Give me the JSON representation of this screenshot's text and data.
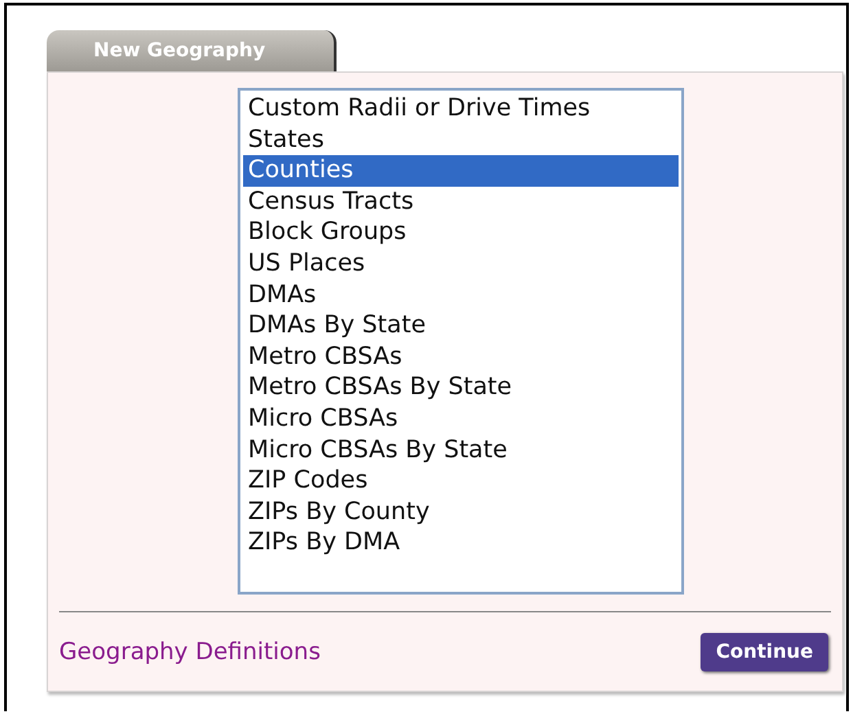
{
  "tab": {
    "label": "New Geography"
  },
  "list": {
    "items": [
      {
        "label": "Custom Radii or Drive Times",
        "selected": false
      },
      {
        "label": "States",
        "selected": false
      },
      {
        "label": "Counties",
        "selected": true
      },
      {
        "label": "Census Tracts",
        "selected": false
      },
      {
        "label": "Block Groups",
        "selected": false
      },
      {
        "label": "US Places",
        "selected": false
      },
      {
        "label": "DMAs",
        "selected": false
      },
      {
        "label": "DMAs By State",
        "selected": false
      },
      {
        "label": "Metro CBSAs",
        "selected": false
      },
      {
        "label": "Metro CBSAs By State",
        "selected": false
      },
      {
        "label": "Micro CBSAs",
        "selected": false
      },
      {
        "label": "Micro CBSAs By State",
        "selected": false
      },
      {
        "label": "ZIP Codes",
        "selected": false
      },
      {
        "label": "ZIPs By County",
        "selected": false
      },
      {
        "label": "ZIPs By DMA",
        "selected": false
      }
    ]
  },
  "link": "Geography Definitions",
  "button": "Continue"
}
